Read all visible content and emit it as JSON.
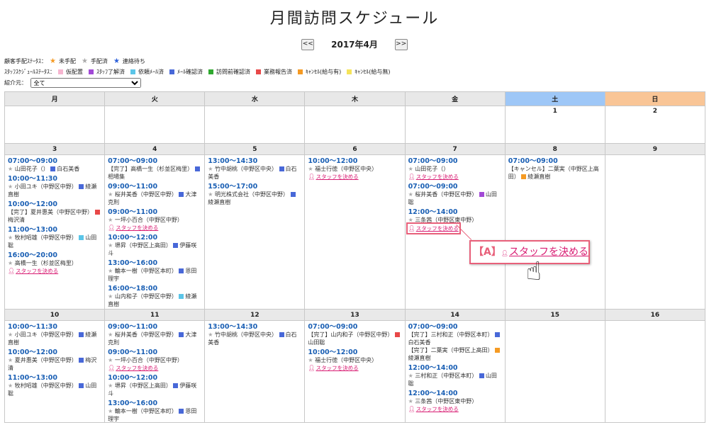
{
  "title": "月間訪問スケジュール",
  "nav": {
    "prev": "<<",
    "month": "2017年4月",
    "next": ">>"
  },
  "legend1": {
    "label": "顧客手配ｽﾃｰﾀｽ：",
    "items": [
      {
        "text": "未手配",
        "color": "#f59a23"
      },
      {
        "text": "手配済",
        "color": "#aaaaaa"
      },
      {
        "text": "連絡待ち",
        "color": "#2b5fd9"
      }
    ]
  },
  "legend2": {
    "label": "ｽﾀｯﾌｽｹｼﾞｭｰﾙｽﾃｰﾀｽ：",
    "items": [
      {
        "text": "仮配置",
        "color": "#f6b6d0"
      },
      {
        "text": "ｽﾀｯﾌ了解済",
        "color": "#a24ad6"
      },
      {
        "text": "依頼ﾒｰﾙ済",
        "color": "#5bc5e8"
      },
      {
        "text": "ﾒｰﾙ確認済",
        "color": "#4868d8"
      },
      {
        "text": "訪問前確認済",
        "color": "#2fa82f"
      },
      {
        "text": "業務報告済",
        "color": "#e84848"
      },
      {
        "text": "ｷｬﾝｾﾙ(給与有)",
        "color": "#f59a23"
      },
      {
        "text": "ｷｬﾝｾﾙ(給与無)",
        "color": "#f5e35a"
      }
    ]
  },
  "filter": {
    "label": "紹介元：",
    "value": "全て"
  },
  "weekdays": [
    "月",
    "火",
    "水",
    "木",
    "金",
    "土",
    "日"
  ],
  "decide_label": "スタッフを決める",
  "weeks": [
    {
      "days": [
        "",
        "",
        "",
        "",
        "",
        "1",
        "2"
      ]
    },
    {
      "days": [
        "3",
        "4",
        "5",
        "6",
        "7",
        "8",
        "9"
      ]
    },
    {
      "days": [
        "10",
        "11",
        "12",
        "13",
        "14",
        "15",
        "16"
      ]
    }
  ],
  "events": {
    "w1d0": [
      {
        "time": "07:00～09:00",
        "who": "山田花子（）",
        "staff": "白石美香",
        "sc": "#4868d8"
      },
      {
        "time": "10:00～11:30",
        "who": "小田ユキ（中野区中野）",
        "staff": "綾瀬直樹",
        "sc": "#4868d8"
      },
      {
        "time": "10:00～12:00",
        "pre": "【完了】",
        "who": "夏井惠美（中野区中野）",
        "staff": "梅沢清",
        "sc": "#e84848"
      },
      {
        "time": "11:00～13:00",
        "who": "牧村昭雄（中野区中野）",
        "staff": "山田聡",
        "sc": "#5bc5e8"
      },
      {
        "time": "16:00～20:00",
        "who": "高橋一生（杉並区梅里）",
        "decide": true
      }
    ],
    "w1d1": [
      {
        "time": "07:00～09:00",
        "pre": "【完了】",
        "who": "高橋一生（杉並区梅里）",
        "staff": "相場集",
        "sc": "#4868d8"
      },
      {
        "time": "09:00～11:00",
        "who": "桜井美香（中野区中野）",
        "staff": "大津克則",
        "sc": "#4868d8"
      },
      {
        "time": "09:00～11:00",
        "who": "一坪小百合（中野区中野）",
        "decide": true
      },
      {
        "time": "10:00～12:00",
        "who": "堺昇（中野区上高田）",
        "staff": "伊藤咲斗",
        "sc": "#4868d8"
      },
      {
        "time": "13:00～16:00",
        "who": "輪本一樹（中野区本町）",
        "staff": "恩田理宇",
        "sc": "#4868d8"
      },
      {
        "time": "16:00～18:00",
        "who": "山内和子（中野区中野）",
        "staff": "綾瀬直樹",
        "sc": "#5bc5e8"
      }
    ],
    "w1d2": [
      {
        "time": "13:00～14:30",
        "who": "竹中胡桃（中野区中央）",
        "staff": "白石美香",
        "sc": "#4868d8"
      },
      {
        "time": "15:00～17:00",
        "who": "明光株式会社（中野区中野）",
        "staff": "綾瀬直樹",
        "sc": "#4868d8"
      }
    ],
    "w1d3": [
      {
        "time": "10:00～12:00",
        "who": "福士行徳（中野区中央）",
        "decide": true
      }
    ],
    "w1d4": [
      {
        "time": "07:00～09:00",
        "who": "山田花子（）",
        "decide": true
      },
      {
        "time": "07:00～09:00",
        "who": "桜井美香（中野区中野）",
        "staff": "山田聡",
        "sc": "#a24ad6"
      },
      {
        "time": "12:00～14:00",
        "who": "三条茜（中野区東中野）",
        "decide": true,
        "hl": true
      }
    ],
    "w1d5": [
      {
        "time": "07:00～09:00",
        "pre": "【キャンセル】",
        "who": "二葉実（中野区上高田）",
        "staff": "綾瀬直樹",
        "sc": "#f59a23"
      }
    ],
    "w2d0": [
      {
        "time": "10:00～11:30",
        "who": "小田ユキ（中野区中野）",
        "staff": "綾瀬直樹",
        "sc": "#4868d8"
      },
      {
        "time": "10:00～12:00",
        "who": "夏井惠美（中野区中野）",
        "staff": "梅沢清",
        "sc": "#4868d8"
      },
      {
        "time": "11:00～13:00",
        "who": "牧村昭雄（中野区中野）",
        "staff": "山田聡",
        "sc": "#4868d8"
      }
    ],
    "w2d1": [
      {
        "time": "09:00～11:00",
        "who": "桜井美香（中野区中野）",
        "staff": "大津克則",
        "sc": "#4868d8"
      },
      {
        "time": "09:00～11:00",
        "who": "一坪小百合（中野区中野）",
        "decide": true
      },
      {
        "time": "10:00～12:00",
        "who": "堺昇（中野区上高田）",
        "staff": "伊藤咲斗",
        "sc": "#4868d8"
      },
      {
        "time": "13:00～16:00",
        "who": "輪本一樹（中野区本町）",
        "staff": "恩田理宇",
        "sc": "#4868d8"
      }
    ],
    "w2d2": [
      {
        "time": "13:00～14:30",
        "who": "竹中胡桃（中野区中央）",
        "staff": "白石美香",
        "sc": "#4868d8"
      }
    ],
    "w2d3": [
      {
        "time": "07:00～09:00",
        "pre": "【完了】",
        "who": "山内和子（中野区中野）",
        "staff": "山田聡",
        "sc": "#e84848"
      },
      {
        "time": "10:00～12:00",
        "who": "福士行徳（中野区中央）",
        "decide": true
      }
    ],
    "w2d4": [
      {
        "time": "07:00～09:00",
        "pre": "【完了】",
        "who": "三村和正（中野区本町）",
        "staff": "白石美香",
        "sc": "#4868d8"
      },
      {
        "time": "",
        "pre": "【完了】",
        "who": "二葉実（中野区上高田）",
        "staff": "綾瀬直樹",
        "sc": "#f59a23"
      },
      {
        "time": "12:00～14:00",
        "who": "三村和正（中野区本町）",
        "staff": "山田聡",
        "sc": "#4868d8"
      },
      {
        "time": "12:00～14:00",
        "who": "三条茜（中野区東中野）",
        "decide": true
      }
    ]
  },
  "callout": {
    "label": "【A】",
    "link": "スタッフを決める"
  }
}
